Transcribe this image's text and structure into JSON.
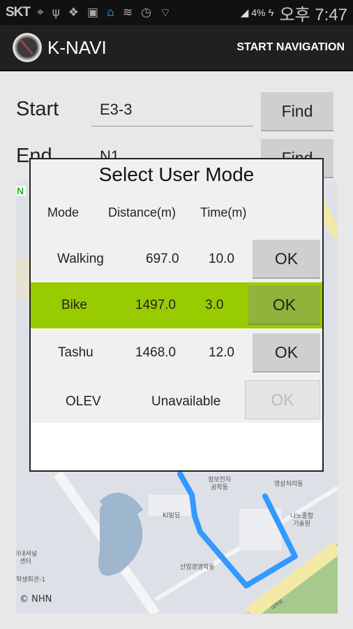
{
  "status_bar": {
    "carrier": "SKT",
    "battery": "4%",
    "time": "오후 7:47",
    "icons": [
      "gps-icon",
      "usb-icon",
      "dropbox-icon",
      "gallery-icon",
      "home-app-icon",
      "mute-icon",
      "alarm-icon",
      "wifi-icon",
      "signal-icon",
      "battery-charging-icon"
    ]
  },
  "action_bar": {
    "title": "K-NAVI",
    "action": "START NAVIGATION"
  },
  "form": {
    "start_label": "Start",
    "start_value": "E3-3",
    "end_label": "End",
    "end_value": "N1",
    "find_label": "Find"
  },
  "map": {
    "labels": [
      "정보전자\n공학동",
      "영상처리동",
      "KI빌딩",
      "나노종합\n기술원",
      "산업경영학동",
      "터내셔널\n센터",
      "학생회관-1",
      "대학로"
    ],
    "copyright": "© NHN",
    "route_color": "#3399ff"
  },
  "dialog": {
    "title": "Select User Mode",
    "headers": [
      "Mode",
      "Distance(m)",
      "Time(m)"
    ],
    "ok_label": "OK",
    "accent": "#99cc00",
    "rows": [
      {
        "mode": "Walking",
        "distance": "697.0",
        "time": "10.0",
        "selected": false,
        "enabled": true
      },
      {
        "mode": "Bike",
        "distance": "1497.0",
        "time": "3.0",
        "selected": true,
        "enabled": true
      },
      {
        "mode": "Tashu",
        "distance": "1468.0",
        "time": "12.0",
        "selected": false,
        "enabled": true
      },
      {
        "mode": "OLEV",
        "distance": "Unavailable",
        "time": "",
        "selected": false,
        "enabled": false
      }
    ]
  }
}
